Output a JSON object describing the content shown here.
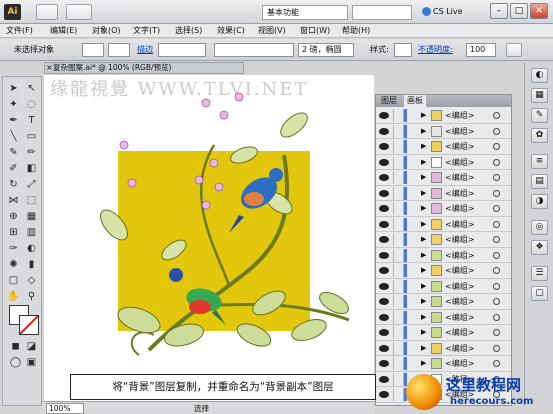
{
  "titlebar": {
    "logo": "Ai",
    "workspace": "基本功能",
    "cs_live": "CS Live",
    "window_controls": [
      "–",
      "□",
      "✕"
    ]
  },
  "menu": [
    "文件(F)",
    "编辑(E)",
    "对象(O)",
    "文字(T)",
    "选择(S)",
    "效果(C)",
    "视图(V)",
    "窗口(W)",
    "帮助(H)"
  ],
  "control_bar": {
    "selection_label": "未选择对象",
    "stroke_link": "描边",
    "stroke_value": "",
    "brush_value": "2 磅，椭圆",
    "style_label": "样式:",
    "opacity_link": "不透明度:",
    "opacity_value": "100"
  },
  "document": {
    "tab_label": "复杂图案.ai* @ 100% (RGB/预览)",
    "close_glyph": "×"
  },
  "watermark": "缘龍視覺 WWW.TLVI.NET",
  "status": {
    "zoom": "100%",
    "text": "选择"
  },
  "layers_panel": {
    "tabs": [
      "图层",
      "画板"
    ],
    "rows": [
      {
        "name": "<编组>",
        "thumb": "#f0d060"
      },
      {
        "name": "<编组>",
        "thumb": "#e6e6e6"
      },
      {
        "name": "<编组>",
        "thumb": "#f0d060"
      },
      {
        "name": "<编组>",
        "thumb": "#ffffff"
      },
      {
        "name": "<编组>",
        "thumb": "#e3b9d8"
      },
      {
        "name": "<编组>",
        "thumb": "#e3b9d8"
      },
      {
        "name": "<编组>",
        "thumb": "#e3b9d8"
      },
      {
        "name": "<编组>",
        "thumb": "#f0d060"
      },
      {
        "name": "<编组>",
        "thumb": "#f0d060"
      },
      {
        "name": "<编组>",
        "thumb": "#c9dc8a"
      },
      {
        "name": "<编组>",
        "thumb": "#f0d060"
      },
      {
        "name": "<编组>",
        "thumb": "#c9dc8a"
      },
      {
        "name": "<编组>",
        "thumb": "#c9dc8a"
      },
      {
        "name": "<编组>",
        "thumb": "#c9dc8a"
      },
      {
        "name": "<编组>",
        "thumb": "#c9dc8a"
      },
      {
        "name": "<编组>",
        "thumb": "#f0d060"
      },
      {
        "name": "<编组>",
        "thumb": "#c9dc8a"
      },
      {
        "name": "<路径>",
        "thumb": "#ffffff"
      },
      {
        "name": "<编组>",
        "thumb": "#f0d060"
      }
    ]
  },
  "caption": "将“背景”图层复制，并重命名为“背景副本”图层",
  "brand": {
    "title": "这里教程网",
    "url": "herecours.com"
  },
  "colors": {
    "artboard": "#e2c70c",
    "layer_color": "#4a78d8",
    "link": "#0a3fa8"
  }
}
